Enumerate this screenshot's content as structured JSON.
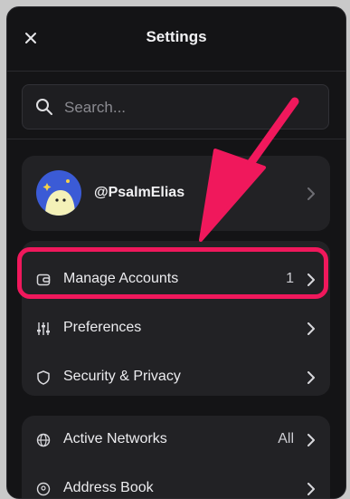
{
  "header": {
    "title": "Settings",
    "close_icon": "close-icon"
  },
  "search": {
    "placeholder": "Search..."
  },
  "profile": {
    "username": "@PsalmElias"
  },
  "menu": [
    {
      "label": "Manage Accounts",
      "value": "1",
      "icon": "wallet-icon"
    },
    {
      "label": "Preferences",
      "value": "",
      "icon": "sliders-icon"
    },
    {
      "label": "Security & Privacy",
      "value": "",
      "icon": "shield-icon"
    }
  ],
  "networks": [
    {
      "label": "Active Networks",
      "value": "All",
      "icon": "globe-icon"
    },
    {
      "label": "Address Book",
      "value": "",
      "icon": "address-book-icon"
    }
  ],
  "annotation": {
    "highlight_color": "#f0185c"
  }
}
